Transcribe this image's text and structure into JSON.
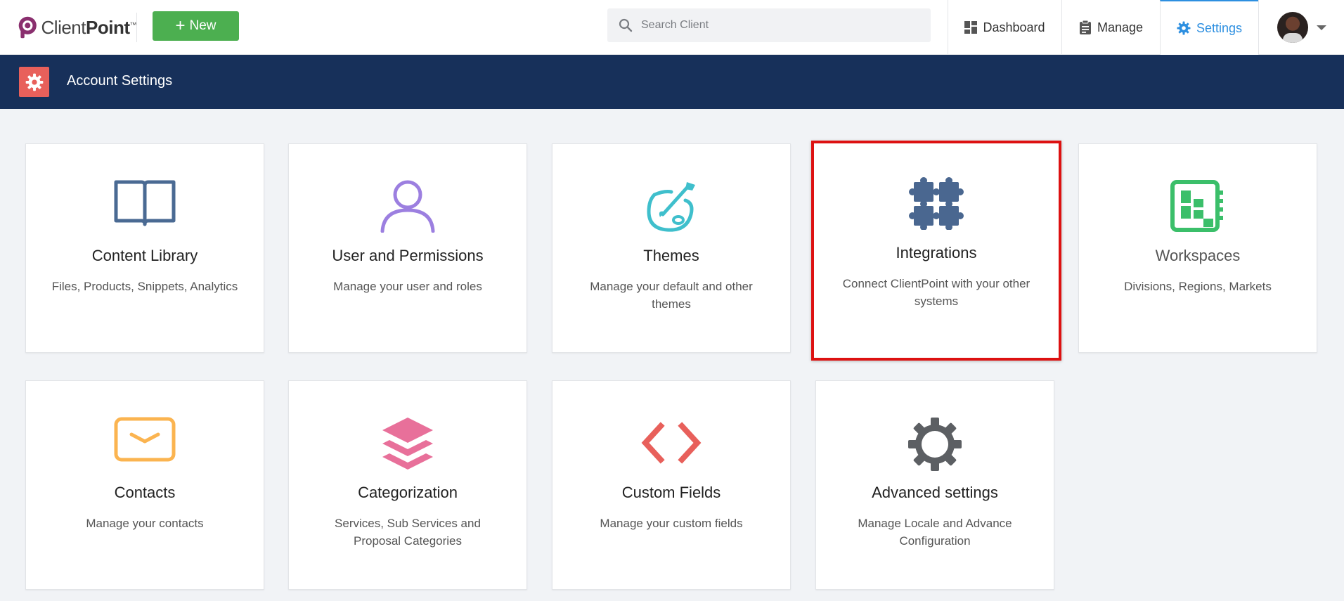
{
  "app": {
    "logo": {
      "brand_light": "Client",
      "brand_bold": "Point",
      "trademark": "™"
    },
    "new_button_label": "New",
    "search": {
      "placeholder": "Search Client",
      "value": ""
    },
    "nav": {
      "dashboard": "Dashboard",
      "manage": "Manage",
      "settings": "Settings"
    },
    "active_nav": "settings"
  },
  "header": {
    "title": "Account Settings"
  },
  "cards": [
    {
      "title": "Content Library",
      "desc": "Files, Products, Snippets, Analytics",
      "icon": "book-icon",
      "color": "#4a6a93"
    },
    {
      "title": "User and Permissions",
      "desc": "Manage your user and roles",
      "icon": "user-icon",
      "color": "#9c7fe0"
    },
    {
      "title": "Themes",
      "desc": "Manage your default and other themes",
      "icon": "palette-icon",
      "color": "#3fbfcc"
    },
    {
      "title": "Integrations",
      "desc": "Connect ClientPoint with your other systems",
      "icon": "puzzle-icon",
      "color": "#4a6790",
      "selected": true
    },
    {
      "title": "Workspaces",
      "desc": "Divisions, Regions, Markets",
      "icon": "workspace-icon",
      "color": "#3bbf6a"
    },
    {
      "title": "Contacts",
      "desc": "Manage your contacts",
      "icon": "envelope-icon",
      "color": "#fbb450"
    },
    {
      "title": "Categorization",
      "desc": "Services, Sub Services and Proposal Categories",
      "icon": "layers-icon",
      "color": "#e8709a"
    },
    {
      "title": "Custom Fields",
      "desc": "Manage your custom fields",
      "icon": "code-icon",
      "color": "#e8605b"
    },
    {
      "title": "Advanced settings",
      "desc": "Manage Locale and Advance Configuration",
      "icon": "gear-icon",
      "color": "#5c5f63"
    }
  ],
  "colors": {
    "accent": "#2d8fe0",
    "new_button": "#4caf50",
    "header_band": "#17305a",
    "header_icon_bg": "#e8605b",
    "selection_outline": "#dd1111"
  }
}
